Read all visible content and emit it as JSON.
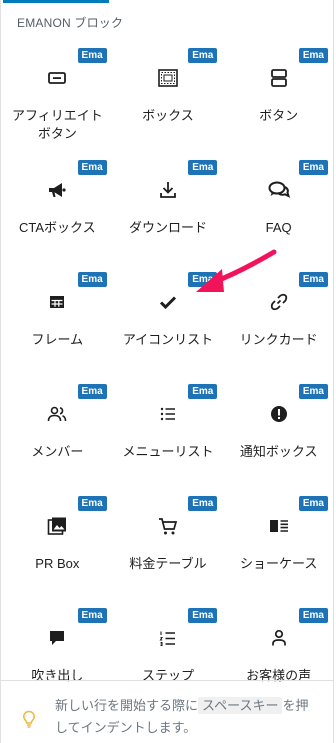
{
  "section": {
    "title": "EMANON ブロック"
  },
  "badge_text": "Ema",
  "colors": {
    "badge": "#1d73b6",
    "accent": "#007cba",
    "arrow": "#f2145a"
  },
  "blocks": [
    {
      "label": "アフィリエイトボタン",
      "icon": "affiliate-button-icon"
    },
    {
      "label": "ボックス",
      "icon": "box-icon"
    },
    {
      "label": "ボタン",
      "icon": "button-icon"
    },
    {
      "label": "CTAボックス",
      "icon": "megaphone-icon"
    },
    {
      "label": "ダウンロード",
      "icon": "download-icon"
    },
    {
      "label": "FAQ",
      "icon": "chat-bubbles-icon"
    },
    {
      "label": "フレーム",
      "icon": "table-icon"
    },
    {
      "label": "アイコンリスト",
      "icon": "check-icon"
    },
    {
      "label": "リンクカード",
      "icon": "link-icon"
    },
    {
      "label": "メンバー",
      "icon": "people-icon"
    },
    {
      "label": "メニューリスト",
      "icon": "list-icon"
    },
    {
      "label": "通知ボックス",
      "icon": "alert-icon"
    },
    {
      "label": "PR Box",
      "icon": "gallery-icon"
    },
    {
      "label": "料金テーブル",
      "icon": "cart-icon"
    },
    {
      "label": "ショーケース",
      "icon": "media-text-icon"
    },
    {
      "label": "吹き出し",
      "icon": "speech-bubble-icon"
    },
    {
      "label": "ステップ",
      "icon": "ordered-list-icon"
    },
    {
      "label": "お客様の声",
      "icon": "person-icon"
    }
  ],
  "tip": {
    "prefix": "新しい行を開始する際に",
    "key": "スペースキー",
    "suffix": "を押してインデントします。",
    "icon": "lightbulb-icon"
  }
}
